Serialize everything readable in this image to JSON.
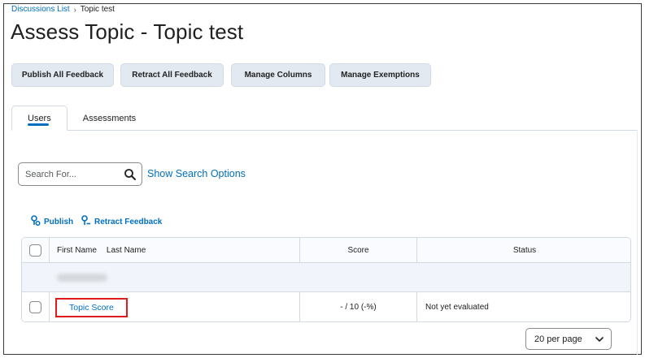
{
  "breadcrumb": {
    "parent": "Discussions List",
    "separator": "›",
    "current": "Topic test"
  },
  "page_title": "Assess Topic - Topic test",
  "toolbar": {
    "publish_all": "Publish All Feedback",
    "retract_all": "Retract All Feedback",
    "manage_columns": "Manage Columns",
    "manage_exemptions": "Manage Exemptions"
  },
  "tabs": [
    {
      "label": "Users",
      "active": true
    },
    {
      "label": "Assessments",
      "active": false
    }
  ],
  "search": {
    "placeholder": "Search For...",
    "value": "",
    "options_link": "Show Search Options"
  },
  "actions": {
    "publish": "Publish",
    "retract": "Retract Feedback"
  },
  "grid": {
    "columns": {
      "first_name": "First Name",
      "last_name": "Last Name",
      "score": "Score",
      "status": "Status"
    },
    "rows": [
      {
        "name": "Topic Score",
        "score": "- / 10 (-%)",
        "status": "Not yet evaluated"
      }
    ]
  },
  "pager": {
    "selected": "20 per page"
  },
  "colors": {
    "link": "#006fbf",
    "button_bg": "#e3e9f1",
    "highlight": "#e01b1b"
  }
}
